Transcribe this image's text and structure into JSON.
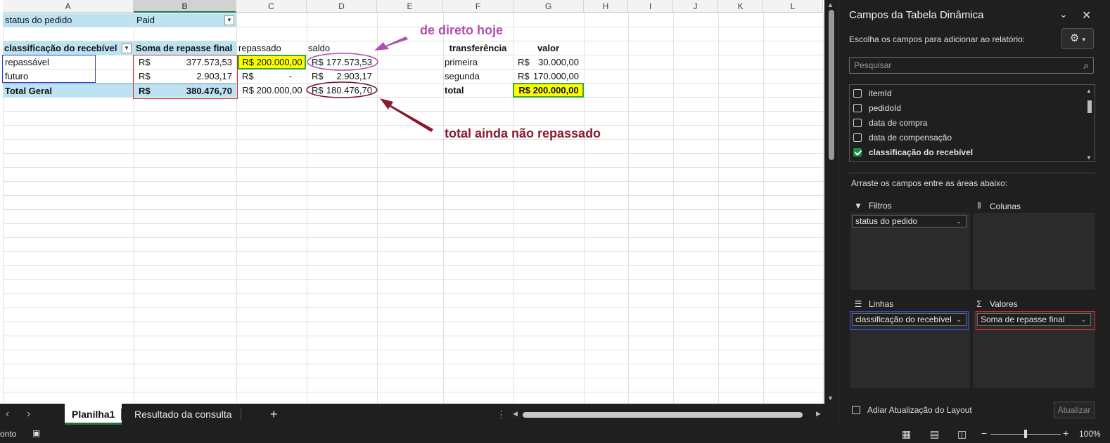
{
  "columns": [
    "A",
    "B",
    "C",
    "D",
    "E",
    "F",
    "G",
    "H",
    "I",
    "J",
    "K",
    "L"
  ],
  "pivot": {
    "filter_label": "status do pedido",
    "filter_value": "Paid",
    "row_header": "classificação do recebível",
    "value_header": "Soma de repasse final",
    "rows": [
      {
        "label": "repassável",
        "currency": "R$",
        "value": "377.573,53"
      },
      {
        "label": "futuro",
        "currency": "R$",
        "value": "2.903,17"
      }
    ],
    "total_label": "Total Geral",
    "total_currency": "R$",
    "total_value": "380.476,70"
  },
  "col_c": {
    "header": "repassado",
    "r1": "R$  200.000,00",
    "r2_currency": "R$",
    "r2_value": "-",
    "r3": "R$  200.000,00"
  },
  "col_d": {
    "header": "saldo",
    "r1_currency": "R$",
    "r1_value": "177.573,53",
    "r2_currency": "R$",
    "r2_value": "2.903,17",
    "r3_currency": "R$",
    "r3_value": "180.476,70"
  },
  "transfers": {
    "header_name": "transferência",
    "header_value": "valor",
    "rows": [
      {
        "name": "primeira",
        "currency": "R$",
        "value": "30.000,00"
      },
      {
        "name": "segunda",
        "currency": "R$",
        "value": "170.000,00"
      }
    ],
    "total_label": "total",
    "total_value": "R$  200.000,00"
  },
  "annotations": {
    "top": "de direto hoje",
    "bottom": "total ainda não repassado",
    "top_color": "#b04fb0",
    "bottom_color": "#8b1a2e"
  },
  "tabs": {
    "sheets": [
      "Planilha1",
      "Resultado da consulta"
    ],
    "add": "+",
    "prev": "‹",
    "next": "›"
  },
  "status": {
    "mode": "onto",
    "zoom": "100%",
    "zoom_minus": "−",
    "zoom_plus": "+"
  },
  "pane": {
    "title": "Campos da Tabela Dinâmica",
    "subtitle": "Escolha os campos para adicionar ao relatório:",
    "search_placeholder": "Pesquisar",
    "fields": [
      {
        "name": "itemId",
        "checked": false
      },
      {
        "name": "pedidoId",
        "checked": false
      },
      {
        "name": "data de compra",
        "checked": false
      },
      {
        "name": "data de compensação",
        "checked": false
      },
      {
        "name": "classificação do recebível",
        "checked": true
      }
    ],
    "areas_label": "Arraste os campos entre as áreas abaixo:",
    "filters_title": "Filtros",
    "columns_title": "Colunas",
    "rows_title": "Linhas",
    "values_title": "Valores",
    "filter_field": "status do pedido",
    "row_field": "classificação do recebível",
    "value_field": "Soma de repasse final",
    "defer_label": "Adiar Atualização do Layout",
    "update_button": "Atualizar"
  },
  "colors": {
    "pivot_header": "#bde3f2",
    "highlight": "#ffff00",
    "excel_green": "#217346"
  }
}
